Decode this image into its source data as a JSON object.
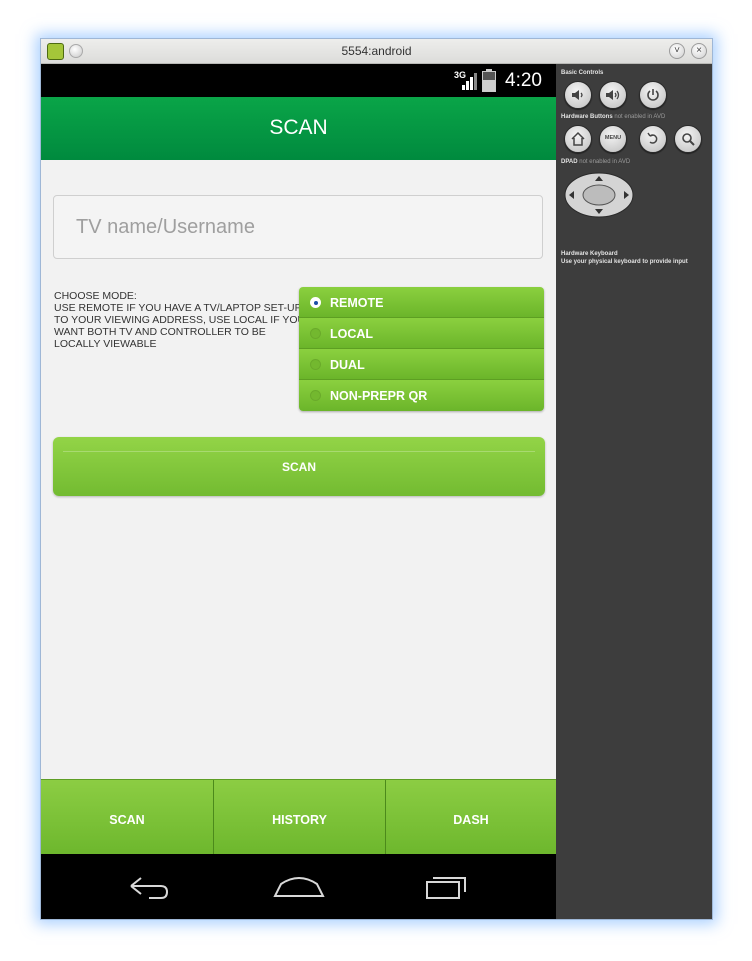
{
  "window": {
    "title": "5554:android"
  },
  "status_bar": {
    "network": "3G",
    "time": "4:20"
  },
  "action_bar": {
    "title": "SCAN"
  },
  "form": {
    "name_placeholder": "TV name/Username",
    "name_value": "",
    "mode_description": [
      "CHOOSE MODE:",
      "USE REMOTE IF YOU HAVE A TV/LAPTOP SET-UP",
      "TO YOUR VIEWING ADDRESS, USE LOCAL IF YOU",
      "WANT BOTH TV AND CONTROLLER TO BE",
      "LOCALLY VIEWABLE"
    ],
    "modes": [
      {
        "label": "REMOTE",
        "selected": true
      },
      {
        "label": "LOCAL",
        "selected": false
      },
      {
        "label": "DUAL",
        "selected": false
      },
      {
        "label": "NON-PREPR QR",
        "selected": false
      }
    ],
    "scan_button": "SCAN"
  },
  "bottom_tabs": [
    "SCAN",
    "HISTORY",
    "DASH"
  ],
  "side_panel": {
    "basic_controls": "Basic Controls",
    "hardware_buttons": "Hardware Buttons",
    "hardware_buttons_note": "not enabled in AVD",
    "menu_label": "MENU",
    "dpad": "DPAD",
    "dpad_note": "not enabled in AVD",
    "keyboard": "Hardware Keyboard",
    "keyboard_note": "Use your physical keyboard to provide input"
  },
  "colors": {
    "action_bar": "#0aa548",
    "accent_green": "#7cc236",
    "radio_selected": "#1c4fa8",
    "panel_bg": "#3d3d3d"
  }
}
